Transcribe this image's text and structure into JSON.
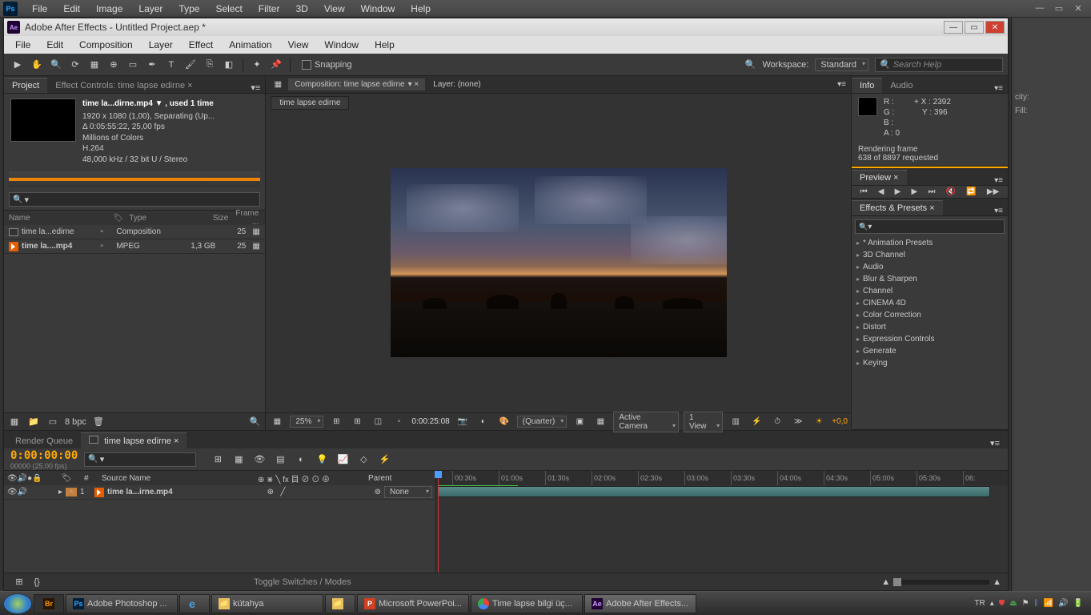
{
  "ps_menu": [
    "File",
    "Edit",
    "Image",
    "Layer",
    "Type",
    "Select",
    "Filter",
    "3D",
    "View",
    "Window",
    "Help"
  ],
  "ae": {
    "title": "Adobe After Effects - Untitled Project.aep *",
    "menu": [
      "File",
      "Edit",
      "Composition",
      "Layer",
      "Effect",
      "Animation",
      "View",
      "Window",
      "Help"
    ],
    "snapping": "Snapping",
    "search_help": "Search Help",
    "workspace_lbl": "Workspace:",
    "workspace_val": "Standard"
  },
  "project": {
    "tab_project": "Project",
    "tab_fx": "Effect Controls: time lapse edirne ×",
    "clip_title": "time la...dirne.mp4 ▼ , used 1 time",
    "res": "1920 x 1080 (1,00), Separating (Up...",
    "dur": "Δ 0:05:55:22, 25,00 fps",
    "colors": "Millions of Colors",
    "codec": "H.264",
    "audio": "48,000 kHz / 32 bit U / Stereo",
    "cols": {
      "name": "Name",
      "type": "Type",
      "size": "Size",
      "frame": "Frame ..."
    },
    "rows": [
      {
        "name": "time la...edirne",
        "type": "Composition",
        "size": "",
        "frame": "25",
        "icon": "comp"
      },
      {
        "name": "time la....mp4",
        "type": "MPEG",
        "size": "1,3 GB",
        "frame": "25",
        "icon": "mov"
      }
    ],
    "bpc": "8 bpc"
  },
  "comp": {
    "tab_composition": "Composition: time lapse edirne",
    "tab_layer": "Layer: (none)",
    "subtab": "time lapse edirne",
    "zoom": "25%",
    "time": "0:00:25:08",
    "quality": "(Quarter)",
    "camera": "Active Camera",
    "views": "1 View"
  },
  "info": {
    "tab_info": "Info",
    "tab_audio": "Audio",
    "R": "R :",
    "G": "G :",
    "B": "B :",
    "A": "A : 0",
    "X": "X : 2392",
    "Y": "Y : 396",
    "render1": "Rendering frame",
    "render2": "638 of 8897 requested"
  },
  "preview": {
    "tab": "Preview ×"
  },
  "effects": {
    "tab": "Effects & Presets ×",
    "cats": [
      "* Animation Presets",
      "3D Channel",
      "Audio",
      "Blur & Sharpen",
      "Channel",
      "CINEMA 4D",
      "Color Correction",
      "Distort",
      "Expression Controls",
      "Generate",
      "Keying"
    ]
  },
  "timeline": {
    "tab_rq": "Render Queue",
    "tab_comp": "time lapse edirne ×",
    "time": "0:00:00:00",
    "time_sub": "00000 (25.00 fps)",
    "col_source": "Source Name",
    "col_sw": "⊕ ⋇ ╲ fx 目 ⊘ ⊙ ⊕",
    "col_parent": "Parent",
    "layer_idx": "1",
    "layer_name": "time la...irne.mp4",
    "parent_none": "None",
    "ticks": [
      "00:30s",
      "01:00s",
      "01:30s",
      "02:00s",
      "02:30s",
      "03:00s",
      "03:30s",
      "04:00s",
      "04:30s",
      "05:00s",
      "05:30s",
      "06:"
    ],
    "toggle": "Toggle Switches / Modes"
  },
  "ps_panels": {
    "opacity_lbl": "city:",
    "fill_lbl": "Fill:"
  },
  "taskbar": {
    "items": [
      {
        "label": "Adobe Photoshop ...",
        "icon": "ps"
      },
      {
        "label": "",
        "icon": "ie",
        "narrow": true
      },
      {
        "label": "kütahya",
        "icon": "folder"
      },
      {
        "label": "",
        "icon": "folder",
        "narrow": true
      },
      {
        "label": "Microsoft PowerPoi...",
        "icon": "pp"
      },
      {
        "label": "Time lapse bilgi üç...",
        "icon": "chrome"
      },
      {
        "label": "Adobe After Effects...",
        "icon": "ae",
        "active": true
      }
    ],
    "lang": "TR"
  }
}
